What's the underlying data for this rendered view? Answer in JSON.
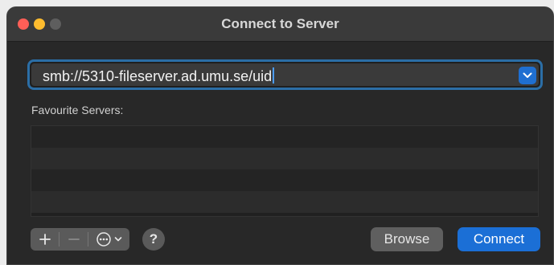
{
  "window": {
    "title": "Connect to Server"
  },
  "address": {
    "value": "smb://5310-fileserver.ad.umu.se/uid"
  },
  "favourites": {
    "label": "Favourite Servers:",
    "rows": [
      "",
      "",
      "",
      ""
    ]
  },
  "toolbar": {
    "add_icon": "plus-icon",
    "remove_icon": "minus-icon",
    "action_icon": "ellipsis-circle-icon",
    "help_label": "?"
  },
  "buttons": {
    "browse": "Browse",
    "connect": "Connect"
  },
  "colors": {
    "accent": "#1b6fd6",
    "focus_ring": "#2b6ea6",
    "close": "#ff5f57",
    "minimize": "#febc2e"
  }
}
